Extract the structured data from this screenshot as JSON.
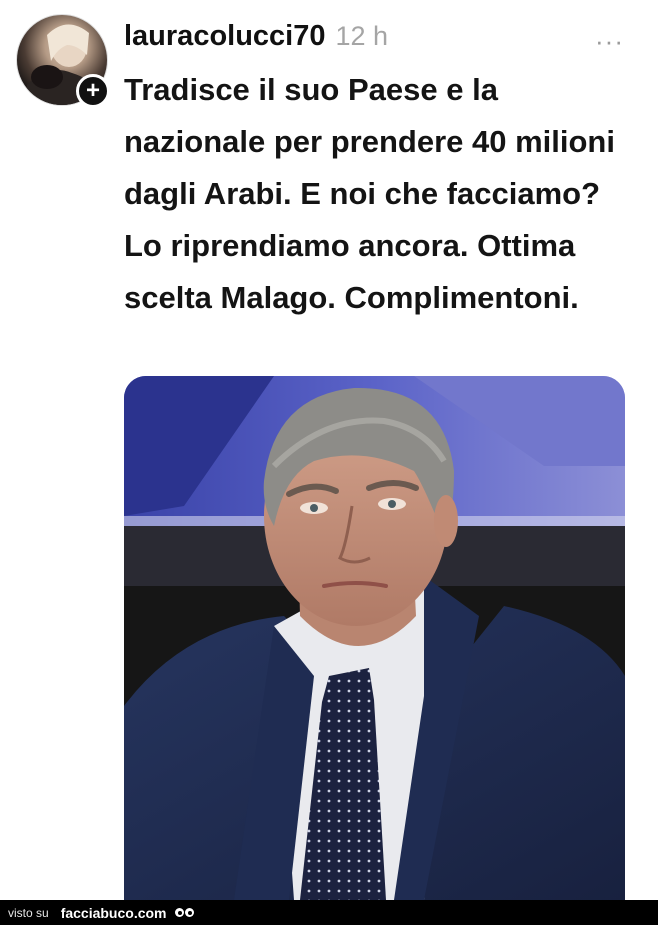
{
  "post": {
    "username": "lauracolucci70",
    "time": "12 h",
    "more_label": "···",
    "follow_symbol": "+",
    "text": "Tradisce il suo Paese e la nazionale per prendere 40 milioni dagli Arabi. E noi che facciamo? Lo riprendiamo ancora. Ottima scelta Malago. Complimentoni."
  },
  "footer": {
    "seen_on": "visto su",
    "site": "facciabuco.com"
  },
  "icons": {
    "more": "more-dots-icon",
    "follow": "plus-icon",
    "logo": "eyes-logo-icon"
  },
  "colors": {
    "text": "#141414",
    "muted": "#a5a5a5",
    "footer_bg": "#000000"
  }
}
